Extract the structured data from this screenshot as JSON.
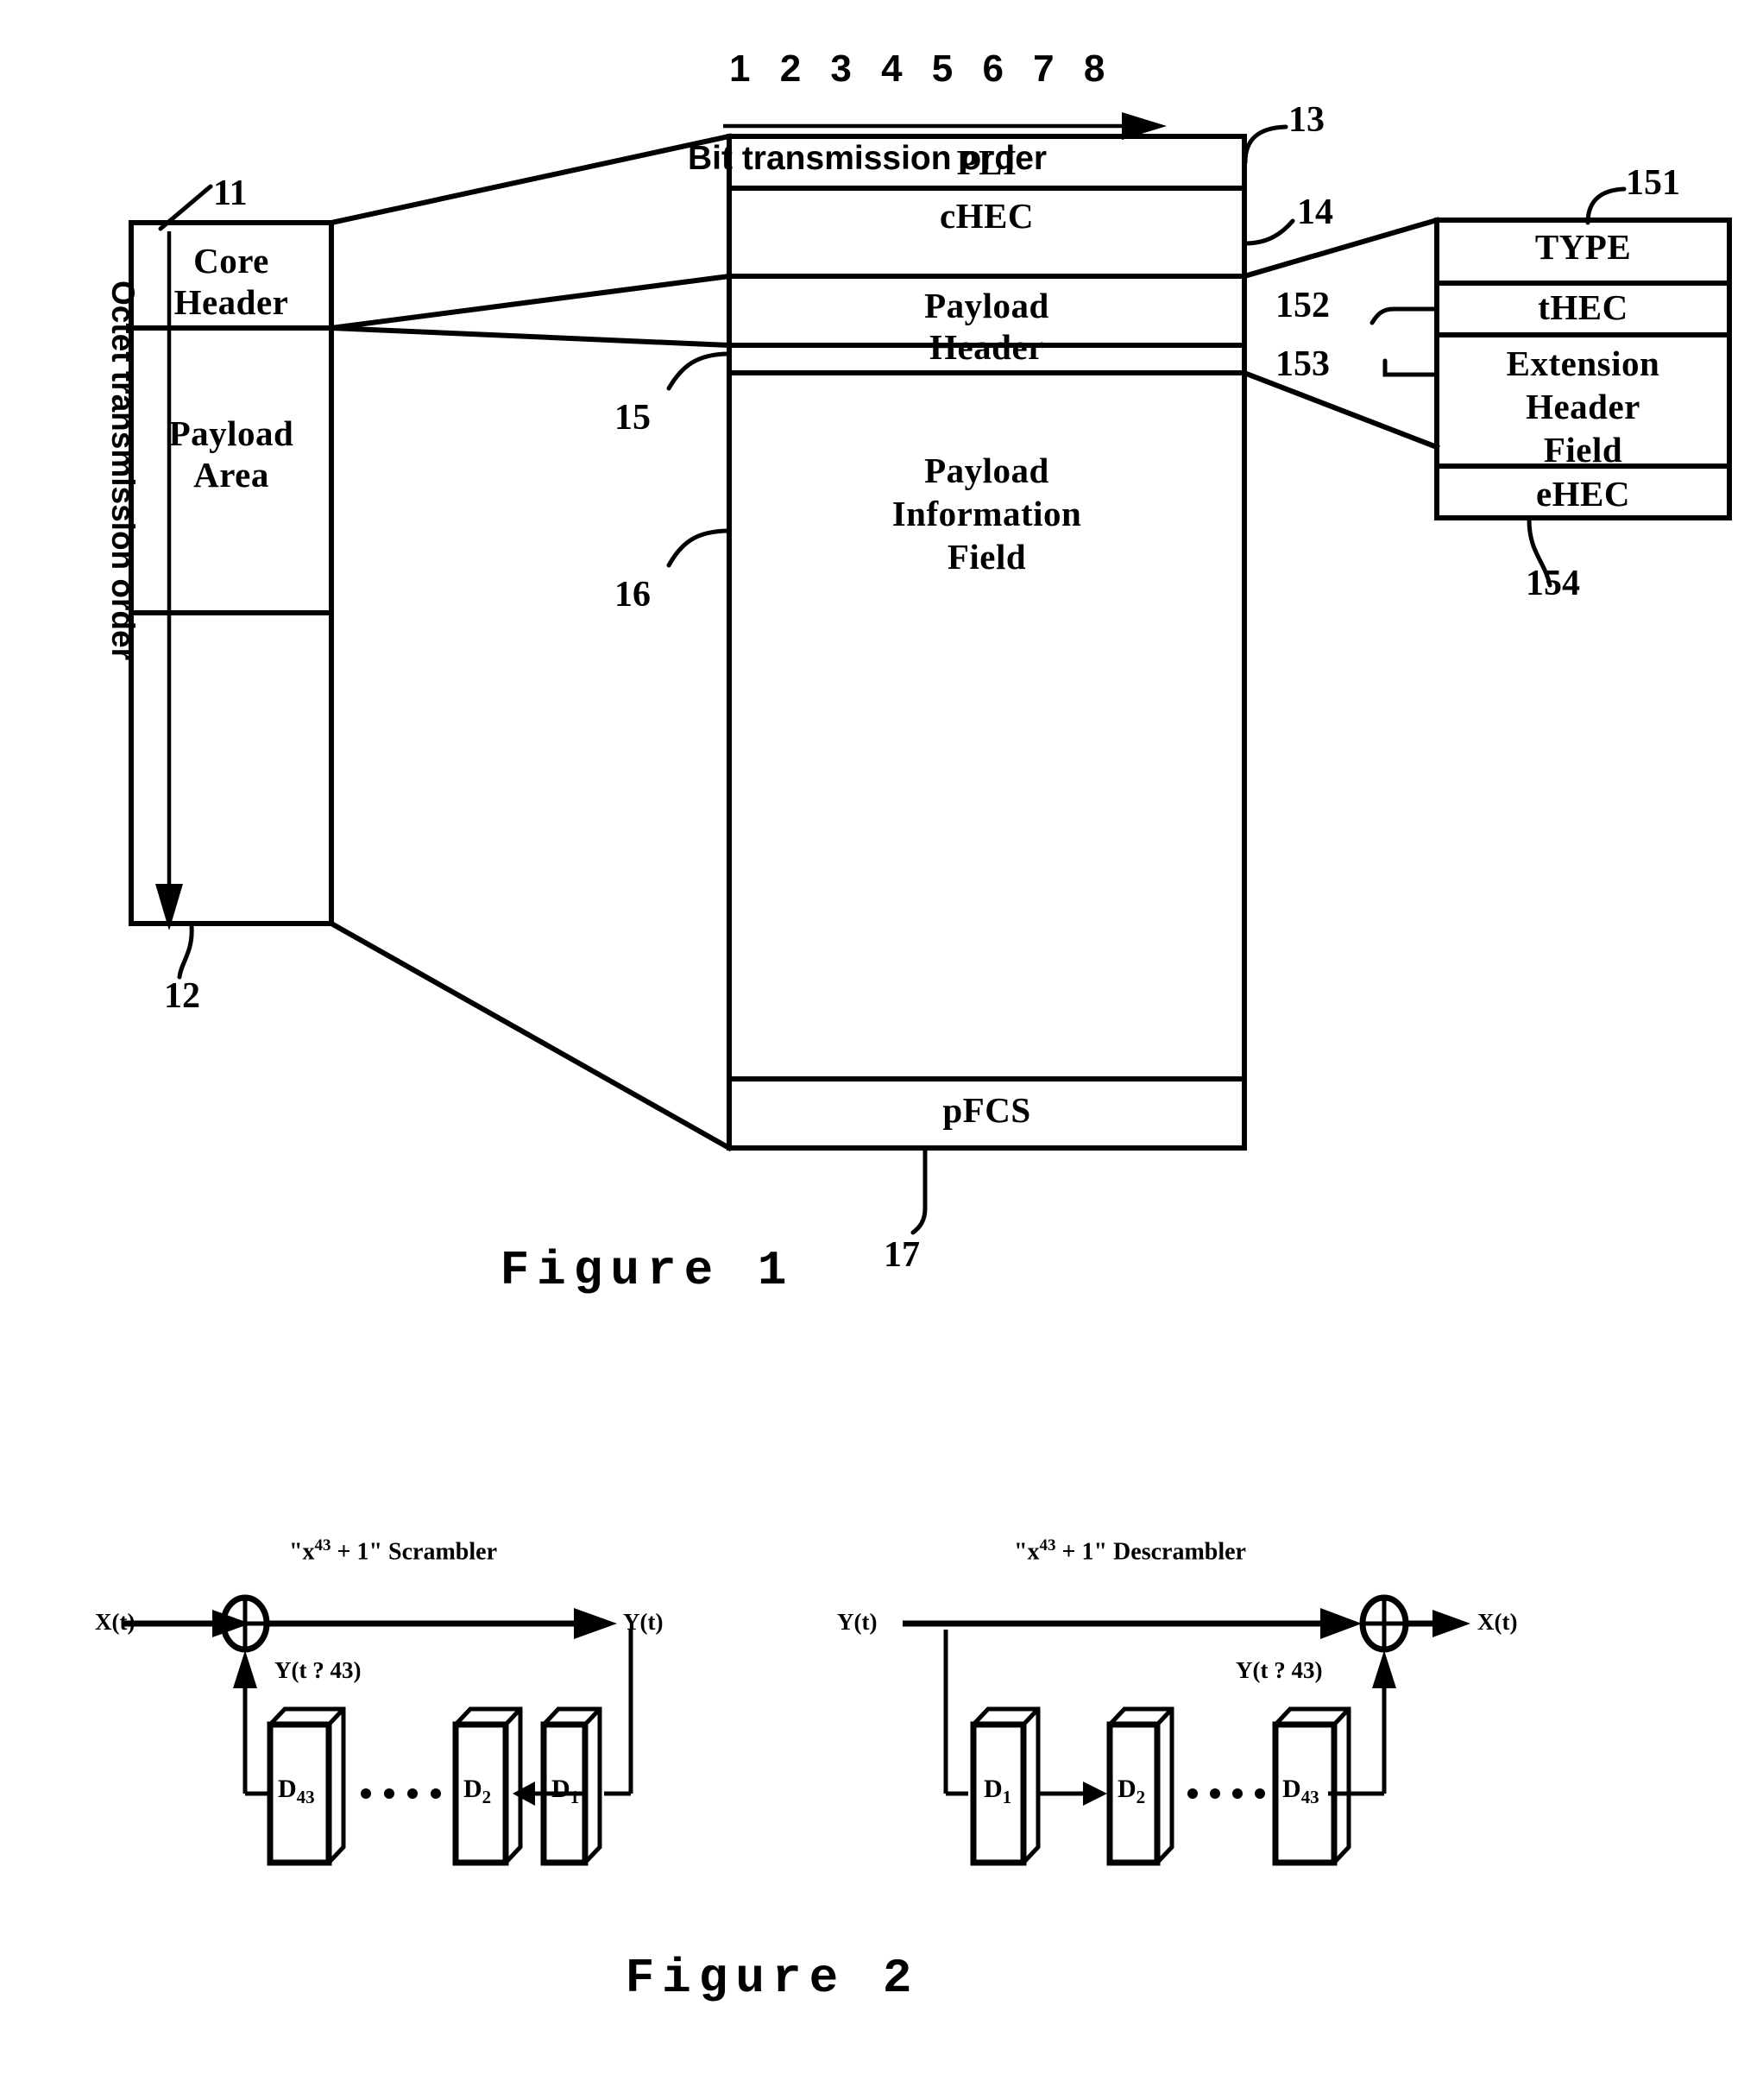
{
  "figure1": {
    "caption": "Figure  1",
    "bit_numbers": "1 2 3 4 5 6 7 8",
    "bit_order_label": "Bit transmission order",
    "octet_order_label": "Octet transmission order",
    "frame": {
      "core_header": "Core\nHeader",
      "core_header_line1": "Core",
      "core_header_line2": "Header",
      "payload_area_line1": "Payload",
      "payload_area_line2": "Area",
      "ref_core_header": "11",
      "ref_payload_area": "12"
    },
    "core_header_detail": {
      "pli": "PLI",
      "chec": "cHEC",
      "ref_pli": "13",
      "ref_chec": "14"
    },
    "payload_area_detail": {
      "payload_header_line1": "Payload",
      "payload_header_line2": "Header",
      "payload_info_line1": "Payload",
      "payload_info_line2": "Information",
      "payload_info_line3": "Field",
      "pfcs": "pFCS",
      "ref_payload_header": "15",
      "ref_payload_info": "16",
      "ref_pfcs": "17"
    },
    "payload_header_detail": {
      "type": "TYPE",
      "thec": "tHEC",
      "ext_header_line1": "Extension",
      "ext_header_line2": "Header",
      "ext_header_line3": "Field",
      "ehec": "eHEC",
      "ref_type": "151",
      "ref_thec": "152",
      "ref_ext_header": "153",
      "ref_ehec": "154"
    }
  },
  "figure2": {
    "caption": "Figure  2",
    "scrambler": {
      "title_prefix": "\"x",
      "title_exponent": "43",
      "title_suffix": " + 1\" Scrambler",
      "input_label": "X(t)",
      "output_label": "Y(t)",
      "feedback_label": "Y(t ? 43)",
      "registers": [
        {
          "name": "D",
          "index": "43"
        },
        {
          "name": "D",
          "index": "2"
        },
        {
          "name": "D",
          "index": "1"
        }
      ],
      "ellipsis": "...."
    },
    "descrambler": {
      "title_prefix": "\"x",
      "title_exponent": "43",
      "title_suffix": " + 1\" Descrambler",
      "input_label": "Y(t)",
      "output_label": "X(t)",
      "feedback_label": "Y(t ? 43)",
      "registers": [
        {
          "name": "D",
          "index": "1"
        },
        {
          "name": "D",
          "index": "2"
        },
        {
          "name": "D",
          "index": "43"
        }
      ],
      "ellipsis": "...."
    }
  },
  "colors": {
    "ink": "#000000",
    "paper": "#ffffff"
  }
}
